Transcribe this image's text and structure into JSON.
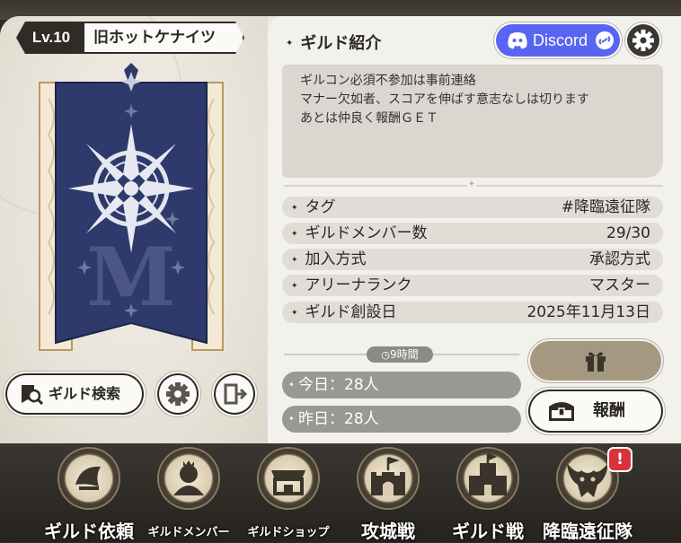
{
  "guild": {
    "level": "Lv.10",
    "name": "旧ホットケナイツ"
  },
  "left_buttons": {
    "search_label": "ギルド検索"
  },
  "intro": {
    "title": "ギルド紹介",
    "discord_label": "Discord",
    "description_lines": [
      "ギルコン必須不参加は事前連絡",
      "マナー欠如者、スコアを伸ばす意志なしは切ります",
      "あとは仲良く報酬ＧＥＴ"
    ]
  },
  "info": [
    {
      "key": "タグ",
      "value": "#降臨遠征隊"
    },
    {
      "key": "ギルドメンバー数",
      "value": "29/30"
    },
    {
      "key": "加入方式",
      "value": "承認方式"
    },
    {
      "key": "アリーナランク",
      "value": "マスター"
    },
    {
      "key": "ギルド創設日",
      "value": "2025年11月13日"
    }
  ],
  "timer": "9時間",
  "today": "今日：28人",
  "yesterday": "昨日：28人",
  "reward_label": "報酬",
  "nav": [
    {
      "label": "ギルド依頼",
      "icon": "scroll-icon"
    },
    {
      "label": "ギルドメンバー",
      "icon": "member-icon"
    },
    {
      "label": "ギルドショップ",
      "icon": "shop-icon"
    },
    {
      "label": "攻城戦",
      "icon": "siege-castle-icon"
    },
    {
      "label": "ギルド戦",
      "icon": "guild-war-castle-icon"
    },
    {
      "label": "降臨遠征隊",
      "icon": "descent-monster-icon"
    }
  ],
  "alert_badge": "!",
  "colors": {
    "banner_navy": "#2e3a6b",
    "discord": "#5865f2",
    "alert": "#d9323a"
  }
}
